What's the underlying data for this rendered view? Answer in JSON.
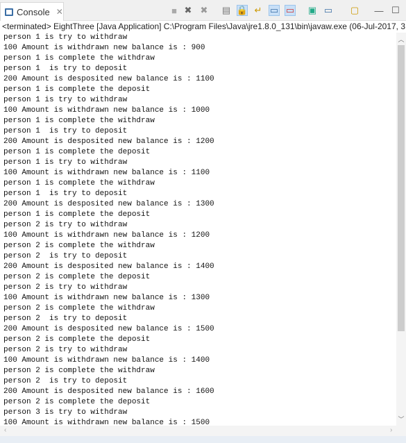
{
  "tab": {
    "label": "Console",
    "close": "✕"
  },
  "toolbar": [
    {
      "name": "terminate-icon",
      "glyph": "■",
      "color": "#aaa"
    },
    {
      "name": "remove-launch-icon",
      "glyph": "✖",
      "color": "#666"
    },
    {
      "name": "remove-all-terminated-icon",
      "glyph": "✖",
      "color": "#999"
    },
    {
      "name": "clear-console-icon",
      "glyph": "▤",
      "color": "#777"
    },
    {
      "name": "scroll-lock-icon",
      "glyph": "🔒",
      "color": "#c90",
      "active": true
    },
    {
      "name": "word-wrap-icon",
      "glyph": "↵",
      "color": "#c90"
    },
    {
      "name": "show-on-stdout-icon",
      "glyph": "▭",
      "color": "#3b6ea5",
      "active": true
    },
    {
      "name": "show-on-stderr-icon",
      "glyph": "▭",
      "color": "#c33",
      "active": true
    },
    {
      "name": "pin-console-icon",
      "glyph": "▣",
      "color": "#2a8"
    },
    {
      "name": "display-console-icon",
      "glyph": "▭",
      "color": "#3b6ea5"
    },
    {
      "name": "open-console-icon",
      "glyph": "▢",
      "color": "#c90"
    },
    {
      "name": "minimize-icon",
      "glyph": "—",
      "color": "#555"
    },
    {
      "name": "maximize-icon",
      "glyph": "☐",
      "color": "#555"
    }
  ],
  "header": "<terminated> EightThree [Java Application] C:\\Program Files\\Java\\jre1.8.0_131\\bin\\javaw.exe (06-Jul-2017, 3:04",
  "lines": [
    "person 1 is try to withdraw",
    "100 Amount is withdrawn new balance is : 900",
    "person 1 is complete the withdraw",
    "person 1  is try to deposit",
    "200 Amount is desposited new balance is : 1100",
    "person 1 is complete the deposit",
    "person 1 is try to withdraw",
    "100 Amount is withdrawn new balance is : 1000",
    "person 1 is complete the withdraw",
    "person 1  is try to deposit",
    "200 Amount is desposited new balance is : 1200",
    "person 1 is complete the deposit",
    "person 1 is try to withdraw",
    "100 Amount is withdrawn new balance is : 1100",
    "person 1 is complete the withdraw",
    "person 1  is try to deposit",
    "200 Amount is desposited new balance is : 1300",
    "person 1 is complete the deposit",
    "person 2 is try to withdraw",
    "100 Amount is withdrawn new balance is : 1200",
    "person 2 is complete the withdraw",
    "person 2  is try to deposit",
    "200 Amount is desposited new balance is : 1400",
    "person 2 is complete the deposit",
    "person 2 is try to withdraw",
    "100 Amount is withdrawn new balance is : 1300",
    "person 2 is complete the withdraw",
    "person 2  is try to deposit",
    "200 Amount is desposited new balance is : 1500",
    "person 2 is complete the deposit",
    "person 2 is try to withdraw",
    "100 Amount is withdrawn new balance is : 1400",
    "person 2 is complete the withdraw",
    "person 2  is try to deposit",
    "200 Amount is desposited new balance is : 1600",
    "person 2 is complete the deposit",
    "person 3 is try to withdraw",
    "100 Amount is withdrawn new balance is : 1500"
  ]
}
